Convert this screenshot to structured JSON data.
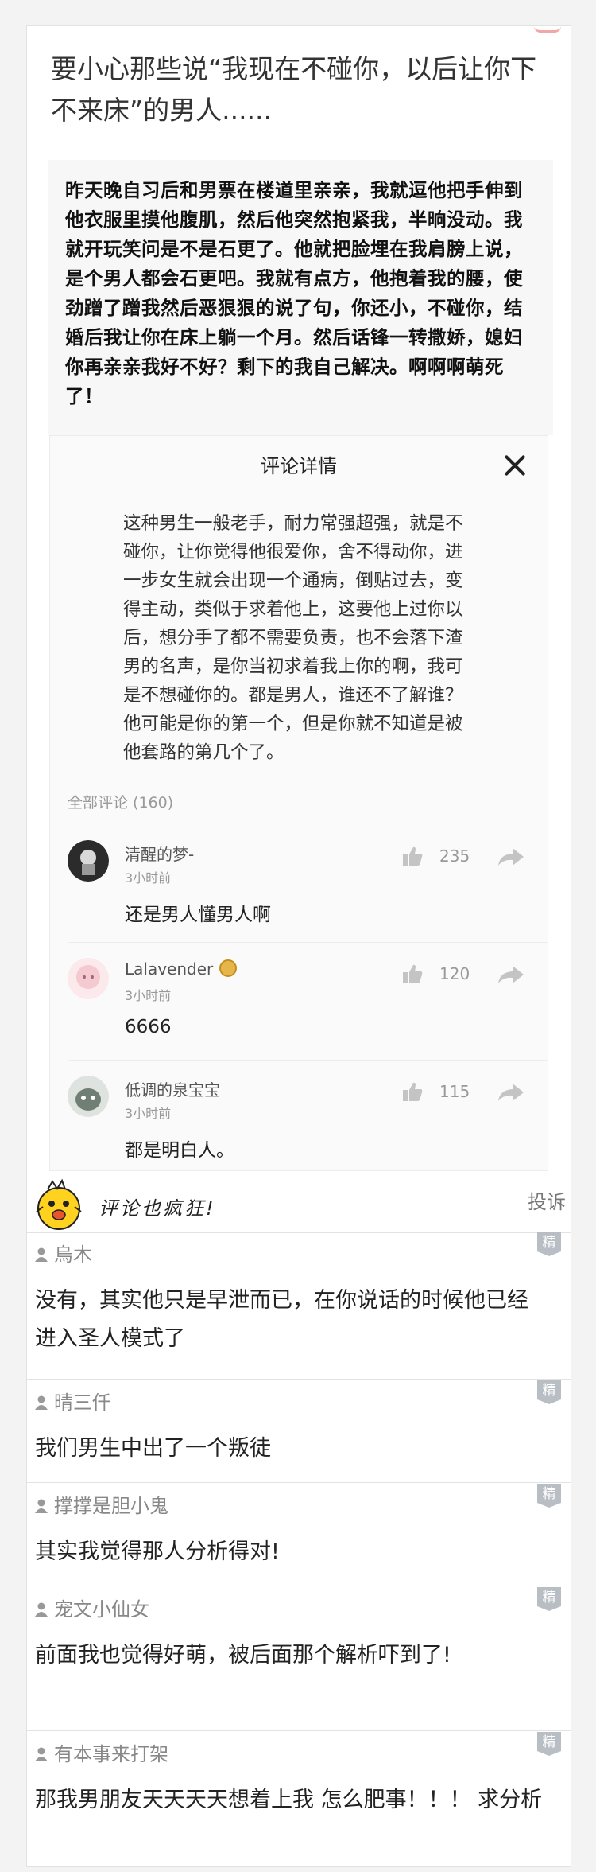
{
  "post": {
    "title": "要小心那些说“我现在不碰你，以后让你下不来床”的男人......",
    "story": "昨天晚自习后和男票在楼道里亲亲，我就逗他把手伸到他衣服里摸他腹肌，然后他突然抱紧我，半晌没动。我就开玩笑问是不是石更了。他就把脸埋在我肩膀上说，是个男人都会石更吧。我就有点方，他抱着我的腰，使劲蹭了蹭我然后恶狠狠的说了句，你还小，不碰你，结婚后我让你在床上躺一个月。然后话锋一转撒娇，媳妇你再亲亲我好不好？剩下的我自己解决。啊啊啊萌死了！"
  },
  "comment_panel": {
    "title": "评论详情",
    "close_icon": "close-icon",
    "analysis": "这种男生一般老手，耐力常强超强，就是不碰你，让你觉得他很爱你，舍不得动你，进一步女生就会出现一个通病，倒贴过去，变得主动，类似于求着他上，这要他上过你以后，想分手了都不需要负责，也不会落下渣男的名声，是你当初求着我上你的啊，我可是不想碰你的。都是男人，谁还不了解谁？他可能是你的第一个，但是你就不知道是被他套路的第几个了。",
    "all_comments_label": "全部评论 (160)",
    "comments": [
      {
        "name": "清醒的梦-",
        "time": "3小时前",
        "likes": "235",
        "text": "还是男人懂男人啊",
        "avatar_color": "#2b2b2b"
      },
      {
        "name": "Lalavender",
        "time": "3小时前",
        "likes": "120",
        "text": "6666",
        "avatar_color": "#f4c9cf"
      },
      {
        "name": "低调的泉宝宝",
        "time": "3小时前",
        "likes": "115",
        "text": "都是明白人。",
        "avatar_color": "#6f7f73"
      }
    ]
  },
  "section": {
    "title": "评论也疯狂!",
    "report_label": "投诉",
    "mascot_icon": "yellow-chick-icon"
  },
  "replies": [
    {
      "user": "烏木",
      "badge": "精",
      "text": "没有，其实他只是早泄而已，在你说话的时候他已经进入圣人模式了"
    },
    {
      "user": "晴三仟",
      "badge": "精",
      "text": "我们男生中出了一个叛徒"
    },
    {
      "user": "撑撑是胆小鬼",
      "badge": "精",
      "text": "其实我觉得那人分析得对!"
    },
    {
      "user": "宠文小仙女",
      "badge": "精",
      "text": "前面我也觉得好萌，被后面那个解析吓到了!"
    },
    {
      "user": "有本事来打架",
      "badge": "精",
      "text": "那我男朋友天天天天想着上我 怎么肥事！！！ 求分析"
    }
  ]
}
